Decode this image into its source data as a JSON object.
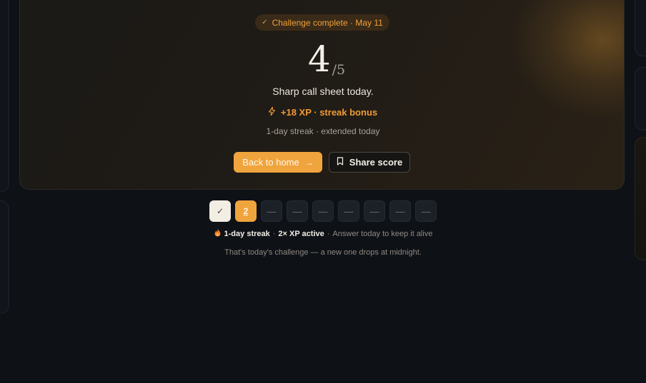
{
  "badge": {
    "text": "Challenge complete · May 11"
  },
  "score": {
    "value": "4",
    "total": "/5"
  },
  "verdict": "Sharp call sheet today.",
  "xp_text": "+18 XP · streak bonus",
  "streak_note": "1-day streak · extended today",
  "buttons": {
    "home": "Back to home",
    "share": "Share score"
  },
  "tracker": [
    {
      "state": "done",
      "label": "✓"
    },
    {
      "state": "current",
      "label": "2"
    },
    {
      "state": "empty",
      "label": "—"
    },
    {
      "state": "empty",
      "label": "—"
    },
    {
      "state": "empty",
      "label": "—"
    },
    {
      "state": "empty",
      "label": "—"
    },
    {
      "state": "empty",
      "label": "—"
    },
    {
      "state": "empty",
      "label": "—"
    },
    {
      "state": "empty",
      "label": "—"
    }
  ],
  "streak_line": {
    "streak": "1-day streak",
    "sep1": "·",
    "multiplier": "2× XP active",
    "sep2": "·",
    "hint": "Answer today to keep it alive"
  },
  "footer_note": "That's today's challenge — a new one drops at midnight.",
  "colors": {
    "accent": "#f0a43e",
    "background": "#0e1116"
  }
}
